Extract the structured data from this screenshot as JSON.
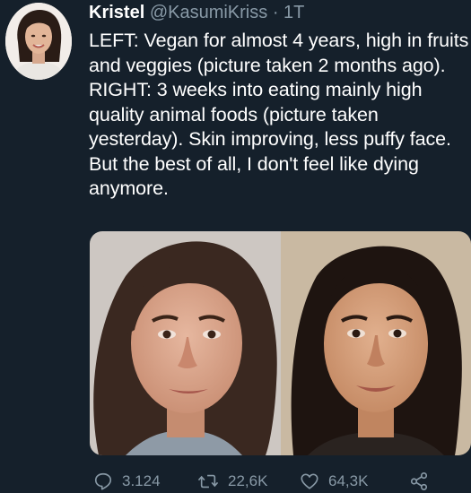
{
  "tweet": {
    "display_name": "Kristel",
    "handle": "@KasumiKriss",
    "separator": "·",
    "time": "1T",
    "text": "LEFT: Vegan for almost 4 years, high in fruits and veggies (picture taken 2 months ago). RIGHT: 3 weeks into eating mainly high quality animal foods (picture taken yesterday). Skin improving, less puffy face. But the best of all, I don't feel like dying anymore.",
    "reply_count": "3.124",
    "retweet_count": "22,6K",
    "like_count": "64,3K"
  },
  "colors": {
    "background": "#15202b",
    "text_primary": "#ffffff",
    "text_secondary": "#8899a6"
  },
  "icons": {
    "reply": "reply-icon",
    "retweet": "retweet-icon",
    "like": "heart-icon",
    "share": "share-icon"
  }
}
